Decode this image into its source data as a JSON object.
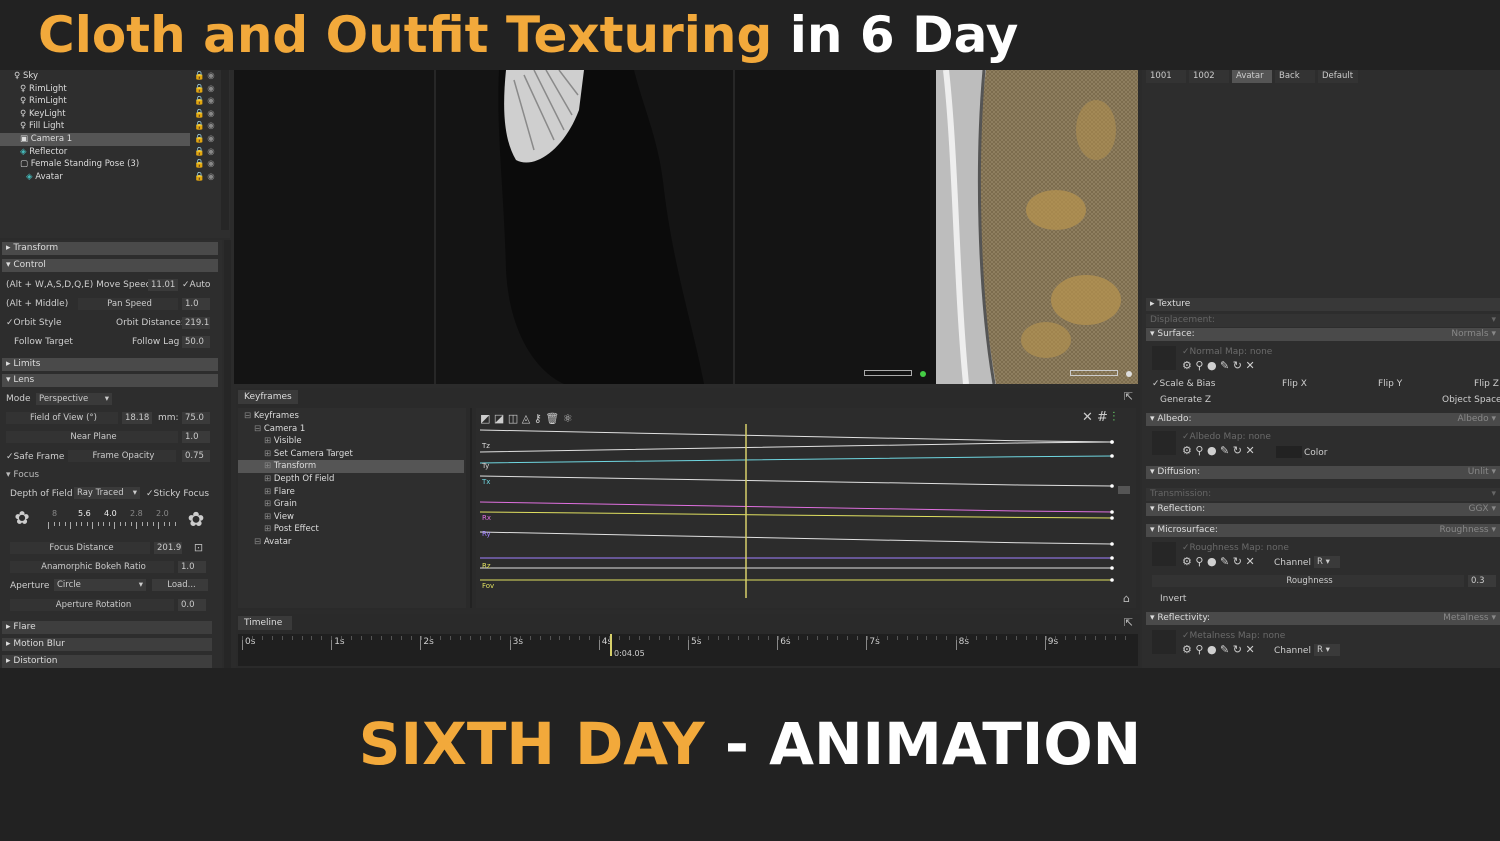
{
  "banner": {
    "title_part1": "Cloth and Outfit Texturing",
    "title_part2": "in 6 Day"
  },
  "caption": {
    "part1": "SIXTH DAY",
    "part2": "- ANIMATION"
  },
  "scene_tree": {
    "items": [
      {
        "label": "Sky",
        "indent": 0
      },
      {
        "label": "RimLight",
        "indent": 1
      },
      {
        "label": "RimLight",
        "indent": 1
      },
      {
        "label": "KeyLight",
        "indent": 1
      },
      {
        "label": "Fill Light",
        "indent": 1
      },
      {
        "label": "Camera 1",
        "indent": 1,
        "selected": true
      },
      {
        "label": "Reflector",
        "indent": 1
      },
      {
        "label": "Female Standing Pose (3)",
        "indent": 1
      },
      {
        "label": "Avatar",
        "indent": 2
      }
    ]
  },
  "left_panel": {
    "transform": "Transform",
    "control": "Control",
    "move_label": "(Alt + W,A,S,D,Q,E) Move Speed:",
    "move_value": "11.01",
    "auto": "Auto",
    "pan_key": "(Alt + Middle)",
    "pan_label": "Pan Speed",
    "pan_value": "1.0",
    "orbit_style": "Orbit Style",
    "orbit_distance_label": "Orbit Distance:",
    "orbit_distance_value": "219.1",
    "follow_target": "Follow Target",
    "follow_lag_label": "Follow Lag",
    "follow_lag_value": "50.0",
    "limits": "Limits",
    "lens": "Lens",
    "mode_label": "Mode",
    "mode_value": "Perspective",
    "fov_label": "Field of View (°)",
    "fov_value": "18.18",
    "mm_label": "mm:",
    "mm_value": "75.0",
    "near_plane_label": "Near Plane",
    "near_plane_value": "1.0",
    "safe_frame": "Safe Frame",
    "frame_opacity_label": "Frame Opacity",
    "frame_opacity_value": "0.75",
    "focus": "Focus",
    "dof_label": "Depth of Field",
    "dof_value": "Ray Traced",
    "sticky_focus": "Sticky Focus",
    "fstops": [
      "8",
      "5.6",
      "4.0",
      "2.8",
      "2.0"
    ],
    "focus_distance_label": "Focus Distance",
    "focus_distance_value": "201.9",
    "bokeh_label": "Anamorphic Bokeh Ratio",
    "bokeh_value": "1.0",
    "aperture_label": "Aperture",
    "aperture_value": "Circle",
    "load": "Load...",
    "aperture_rotation_label": "Aperture Rotation",
    "aperture_rotation_value": "0.0",
    "flare": "Flare",
    "motion_blur": "Motion Blur",
    "distortion": "Distortion"
  },
  "keyframes": {
    "tab": "Keyframes",
    "tree": [
      {
        "label": "Keyframes",
        "indent": 0
      },
      {
        "label": "Camera 1",
        "indent": 1
      },
      {
        "label": "Visible",
        "indent": 2
      },
      {
        "label": "Set Camera Target",
        "indent": 2
      },
      {
        "label": "Transform",
        "indent": 2,
        "selected": true
      },
      {
        "label": "Depth Of Field",
        "indent": 2
      },
      {
        "label": "Flare",
        "indent": 2
      },
      {
        "label": "Grain",
        "indent": 2
      },
      {
        "label": "View",
        "indent": 2
      },
      {
        "label": "Post Effect",
        "indent": 2
      },
      {
        "label": "Avatar",
        "indent": 1
      }
    ],
    "curve_labels": [
      "Tz",
      "Ty",
      "Tx",
      "Rx",
      "Ry",
      "Rz",
      "Fov"
    ]
  },
  "timeline": {
    "tab": "Timeline",
    "ticks": [
      "0s",
      "1s",
      "2s",
      "3s",
      "4s",
      "5s",
      "6s",
      "7s",
      "8s",
      "9s"
    ],
    "current_time": "0:04.05"
  },
  "material_tabs": [
    "1001",
    "1002",
    "Avatar",
    "Back",
    "Default"
  ],
  "material": {
    "texture": "Texture",
    "displacement": "Displacement:",
    "surface": "Surface:",
    "surface_value": "Normals",
    "normal_map": "Normal Map:",
    "none": "none",
    "scale_bias": "Scale & Bias",
    "flip_x": "Flip X",
    "flip_y": "Flip Y",
    "flip_z": "Flip Z",
    "generate_z": "Generate Z",
    "object_space": "Object Space",
    "albedo": "Albedo:",
    "albedo_value": "Albedo",
    "albedo_map": "Albedo Map:",
    "color": "Color",
    "diffusion": "Diffusion:",
    "diffusion_value": "Unlit",
    "transmission": "Transmission:",
    "reflection": "Reflection:",
    "reflection_value": "GGX",
    "microsurface": "Microsurface:",
    "microsurface_value": "Roughness",
    "roughness_map": "Roughness Map:",
    "channel": "Channel",
    "channel_value": "R",
    "roughness": "Roughness",
    "roughness_value": "0.3",
    "invert": "Invert",
    "reflectivity": "Reflectivity:",
    "reflectivity_value": "Metalness",
    "metalness_map": "Metalness Map:"
  },
  "colors": {
    "accent_orange": "#f2a93b",
    "white": "#ffffff",
    "playhead": "#d6cf6a"
  }
}
